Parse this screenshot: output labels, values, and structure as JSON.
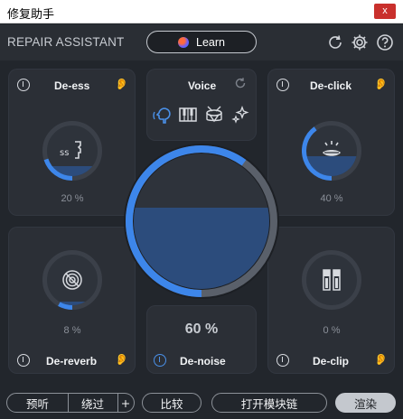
{
  "window": {
    "title": "修复助手",
    "close_label": "x"
  },
  "header": {
    "brand": "REPAIR ASSISTANT",
    "learn_label": "Learn"
  },
  "modules": {
    "de_ess": {
      "name": "De-ess",
      "percent_label": "20 %",
      "value": 0.2
    },
    "de_click": {
      "name": "De-click",
      "percent_label": "40 %",
      "value": 0.4
    },
    "de_reverb": {
      "name": "De-reverb",
      "percent_label": "8 %",
      "value": 0.08
    },
    "de_clip": {
      "name": "De-clip",
      "percent_label": "0 %",
      "value": 0.0
    },
    "de_noise": {
      "name": "De-noise",
      "percent_label": "60 %",
      "value": 0.6
    },
    "voice": {
      "name": "Voice"
    }
  },
  "colors": {
    "accent": "#3d86ea",
    "fill": "#2c4c7c",
    "panel": "#2b2f36"
  },
  "bottom": {
    "preview": "预听",
    "bypass": "绕过",
    "plus": "+",
    "compare": "比较",
    "open_chain": "打开模块链",
    "render": "渲染"
  }
}
